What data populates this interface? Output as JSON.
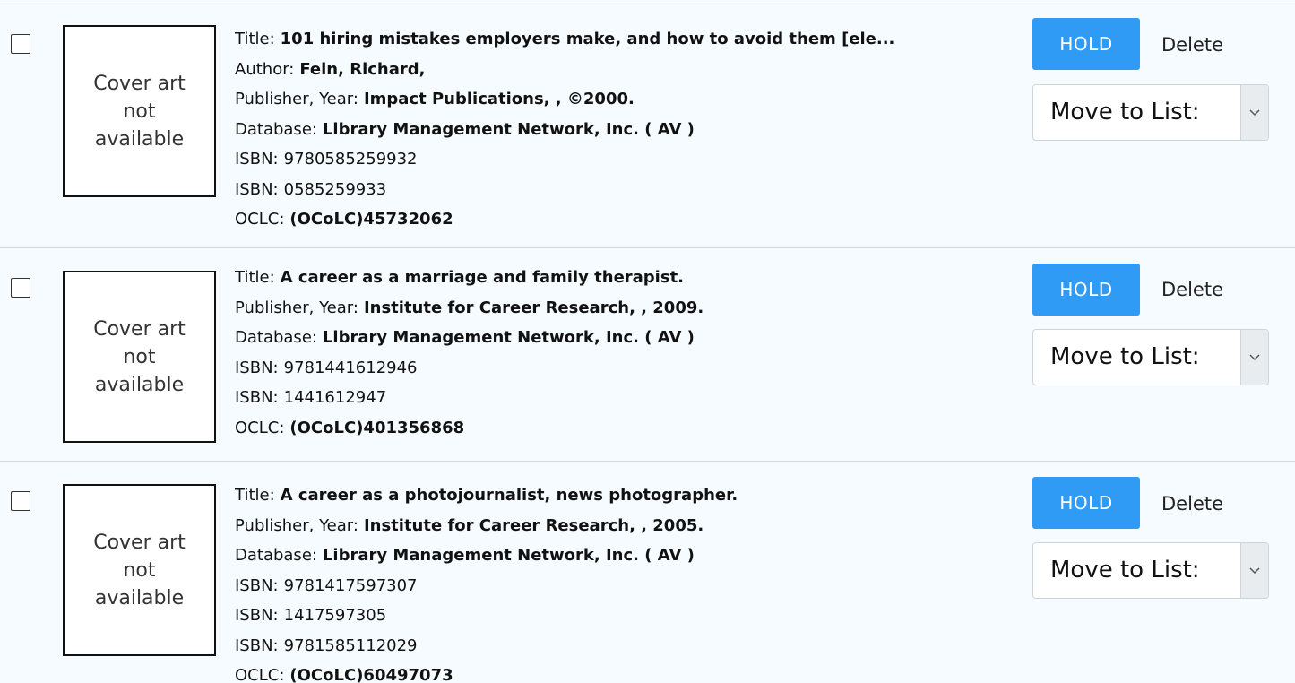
{
  "common": {
    "cover_text": "Cover art not available",
    "hold_label": "HOLD",
    "delete_label": "Delete",
    "move_to_list_label": "Move to List:"
  },
  "records": [
    {
      "fields": [
        {
          "label": "Title:",
          "value": "101 hiring mistakes employers make, and how to avoid them [ele...",
          "bold": true
        },
        {
          "label": "Author:",
          "value": "Fein, Richard,",
          "bold": true
        },
        {
          "label": "Publisher, Year:",
          "value": "Impact Publications, , ©2000.",
          "bold": true
        },
        {
          "label": "Database:",
          "value": "Library Management Network, Inc. ( AV )",
          "bold": true
        },
        {
          "label": "ISBN:",
          "value": "9780585259932",
          "bold": false
        },
        {
          "label": "ISBN:",
          "value": "0585259933",
          "bold": false
        },
        {
          "label": "OCLC:",
          "value": "(OCoLC)45732062",
          "bold": true
        }
      ]
    },
    {
      "fields": [
        {
          "label": "Title:",
          "value": "A career as a marriage and family therapist.",
          "bold": true
        },
        {
          "label": "Publisher, Year:",
          "value": "Institute for Career Research, , 2009.",
          "bold": true
        },
        {
          "label": "Database:",
          "value": "Library Management Network, Inc. ( AV )",
          "bold": true
        },
        {
          "label": "ISBN:",
          "value": "9781441612946",
          "bold": false
        },
        {
          "label": "ISBN:",
          "value": "1441612947",
          "bold": false
        },
        {
          "label": "OCLC:",
          "value": "(OCoLC)401356868",
          "bold": true
        }
      ]
    },
    {
      "fields": [
        {
          "label": "Title:",
          "value": "A career as a photojournalist, news photographer.",
          "bold": true
        },
        {
          "label": "Publisher, Year:",
          "value": "Institute for Career Research, , 2005.",
          "bold": true
        },
        {
          "label": "Database:",
          "value": "Library Management Network, Inc. ( AV )",
          "bold": true
        },
        {
          "label": "ISBN:",
          "value": "9781417597307",
          "bold": false
        },
        {
          "label": "ISBN:",
          "value": "1417597305",
          "bold": false
        },
        {
          "label": "ISBN:",
          "value": "9781585112029",
          "bold": false
        },
        {
          "label": "OCLC:",
          "value": "(OCoLC)60497073",
          "bold": true
        }
      ]
    }
  ],
  "colors": {
    "hold_button": "#2f9bf5",
    "background": "#f6fbff"
  },
  "icons": {
    "select_arrow": "chevron-down-icon"
  }
}
